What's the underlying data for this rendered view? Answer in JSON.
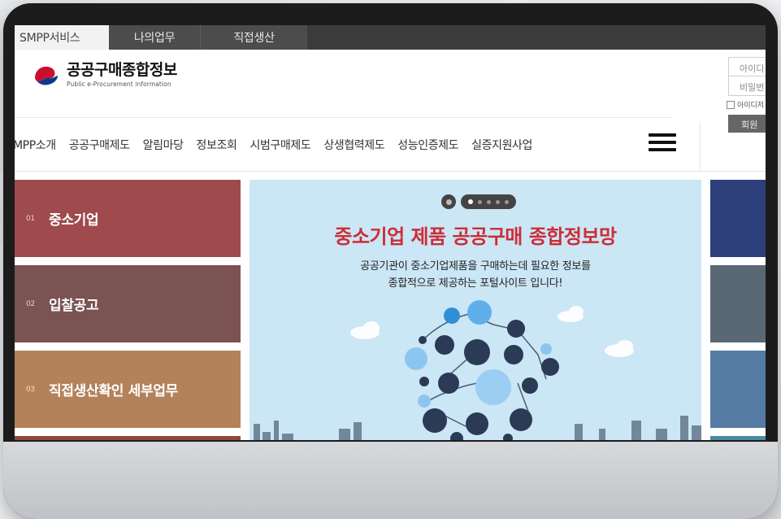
{
  "topbar": {
    "tabs": [
      {
        "label": "SMPP서비스"
      },
      {
        "label": "나의업무"
      },
      {
        "label": "직접생산"
      }
    ]
  },
  "logo": {
    "title": "공공구매종합정보",
    "subtitle": "Public e-Procurement information"
  },
  "login": {
    "id_placeholder": "아이디",
    "pw_placeholder": "비밀번",
    "save_label": "아이디저",
    "join_label": "회원"
  },
  "gnb": {
    "items": [
      {
        "label": "MPP소개"
      },
      {
        "label": "공공구매제도"
      },
      {
        "label": "알림마당"
      },
      {
        "label": "정보조회"
      },
      {
        "label": "시범구매제도"
      },
      {
        "label": "상생협력제도"
      },
      {
        "label": "성능인증제도"
      },
      {
        "label": "실증지원사업"
      }
    ]
  },
  "tiles": [
    {
      "num": "01",
      "label": "중소기업",
      "color": "#9f4a4c"
    },
    {
      "num": "02",
      "label": "입찰공고",
      "color": "#7a5352"
    },
    {
      "num": "03",
      "label": "직접생산확인 세부업무",
      "color": "#b3825a"
    },
    {
      "num": "",
      "label": "",
      "color": "#8b4b3a"
    }
  ],
  "hero": {
    "title": "중소기업 제품 공공구매 종합정보망",
    "sub_line1": "공공기관이 중소기업제품을 구매하는데 필요한 정보를",
    "sub_line2": "종합적으로 제공하는 포털사이트 입니다!",
    "title_color": "#cc2d36",
    "bg_color": "#cbe6f4",
    "slide_count": 5,
    "active_slide": 1
  },
  "right_tiles": [
    {
      "color": "#2d3f7a"
    },
    {
      "color": "#5a6876"
    },
    {
      "color": "#557aa3"
    },
    {
      "color": "#4b8aa0"
    }
  ]
}
